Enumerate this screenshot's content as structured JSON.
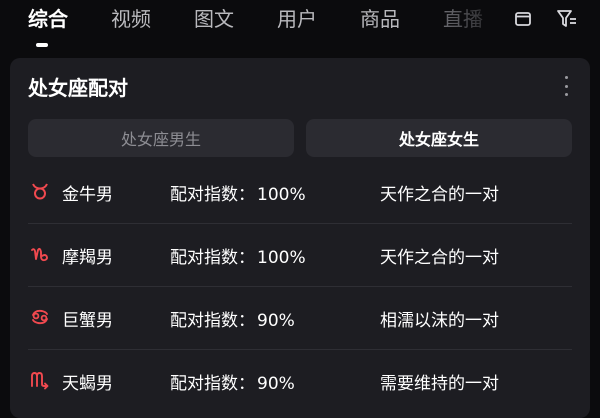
{
  "tabs": [
    {
      "label": "综合",
      "active": true
    },
    {
      "label": "视频",
      "active": false
    },
    {
      "label": "图文",
      "active": false
    },
    {
      "label": "用户",
      "active": false
    },
    {
      "label": "商品",
      "active": false
    },
    {
      "label": "直播",
      "active": false
    }
  ],
  "top_icons": [
    "window-icon",
    "filter-icon"
  ],
  "card": {
    "title": "处女座配对",
    "toggle": {
      "left_label": "处女座男生",
      "right_label": "处女座女生",
      "selected": "right"
    },
    "rows": [
      {
        "icon": "taurus-icon",
        "sign": "金牛男",
        "label": "配对指数：",
        "value": "100%",
        "desc": "天作之合的一对"
      },
      {
        "icon": "capricorn-icon",
        "sign": "摩羯男",
        "label": "配对指数：",
        "value": "100%",
        "desc": "天作之合的一对"
      },
      {
        "icon": "cancer-icon",
        "sign": "巨蟹男",
        "label": "配对指数：",
        "value": "90%",
        "desc": "相濡以沫的一对"
      },
      {
        "icon": "scorpio-icon",
        "sign": "天蝎男",
        "label": "配对指数：",
        "value": "90%",
        "desc": "需要维持的一对"
      }
    ]
  },
  "colors": {
    "background": "#0b0b0d",
    "card": "#1d1d22",
    "accent_red": "#f0494f",
    "muted_text": "#8d8d93"
  }
}
